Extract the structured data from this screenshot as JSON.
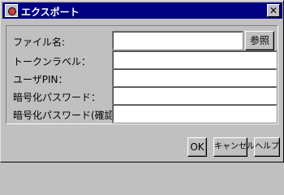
{
  "window": {
    "title": "エクスポート",
    "close_label": "✕"
  },
  "form": {
    "filename_label": "ファイル名:",
    "filename_value": "",
    "browse_label": "参照",
    "token_label_label": "トークンラベル：",
    "token_label_value": "",
    "user_pin_label": "ユーザPIN：",
    "user_pin_value": "",
    "enc_password_label": "暗号化パスワード：",
    "enc_password_value": "",
    "enc_password_confirm_label": "暗号化パスワード(確認)：",
    "enc_password_confirm_value": ""
  },
  "buttons": {
    "ok": "OK",
    "cancel": "キャンセル",
    "help": "ヘルプ"
  },
  "colors": {
    "titlebar": "#000080",
    "face": "#c0c0c0"
  }
}
